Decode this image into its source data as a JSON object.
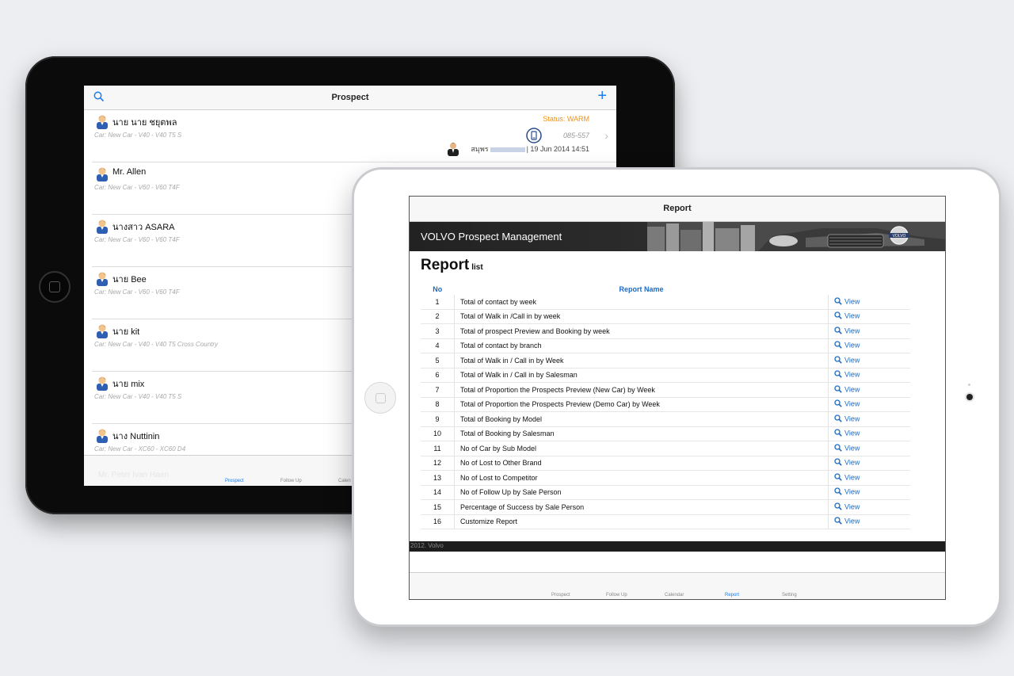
{
  "prospect": {
    "title": "Prospect",
    "items": [
      {
        "name": "นาย  นาย ชยุตพล",
        "car": "Car: New Car - V40 - V40 T5 S",
        "status": "Status: WARM",
        "phone": "085-557",
        "salesman": "สมุพร",
        "date": "| 19 Jun 2014 14:51"
      },
      {
        "name": "Mr. Allen",
        "car": "Car: New Car - V60 - V60 T4F"
      },
      {
        "name": "นางสาว ASARA",
        "car": "Car: New Car - V60 - V60 T4F"
      },
      {
        "name": "นาย Bee",
        "car": "Car: New Car - V60 - V60 T4F"
      },
      {
        "name": "นาย kit",
        "car": "Car: New Car - V40 - V40 T5 Cross Country"
      },
      {
        "name": "นาย mix",
        "car": "Car: New Car - V40 - V40 T5 S"
      },
      {
        "name": "นาง Nuttinin",
        "car": "Car: New Car - XC60 - XC60 D4"
      }
    ],
    "ghost_row": "Mr. Peter Ivan Haan",
    "tabs": [
      "Prospect",
      "Follow Up",
      "Calen"
    ],
    "active_tab": "Prospect"
  },
  "report": {
    "title": "Report",
    "banner_text": "VOLVO Prospect Management",
    "heading": "Report",
    "subheading": "list",
    "col_no": "No",
    "col_name": "Report Name",
    "view_label": "View",
    "rows": [
      {
        "no": "1",
        "name": "Total of contact by week"
      },
      {
        "no": "2",
        "name": "Total of Walk in /Call in by week"
      },
      {
        "no": "3",
        "name": "Total of prospect Preview and Booking by week"
      },
      {
        "no": "4",
        "name": "Total of contact by branch"
      },
      {
        "no": "5",
        "name": "Total of Walk in / Call in by Week"
      },
      {
        "no": "6",
        "name": "Total of Walk in / Call in by Salesman"
      },
      {
        "no": "7",
        "name": "Total of Proportion the Prospects Preview (New Car) by Week"
      },
      {
        "no": "8",
        "name": "Total of Proportion the Prospects Preview (Demo Car) by Week"
      },
      {
        "no": "9",
        "name": "Total of Booking by Model"
      },
      {
        "no": "10",
        "name": "Total of Booking by Salesman"
      },
      {
        "no": "11",
        "name": "No of Car by Sub Model"
      },
      {
        "no": "12",
        "name": "No of Lost to Other Brand"
      },
      {
        "no": "13",
        "name": "No of Lost to Competitor"
      },
      {
        "no": "14",
        "name": "No of Follow Up by Sale Person"
      },
      {
        "no": "15",
        "name": "Percentage of Success by Sale Person"
      },
      {
        "no": "16",
        "name": "Customize Report"
      }
    ],
    "footer": "2012. Volvo",
    "tabs": [
      "Prospect",
      "Follow Up",
      "Calendar",
      "Report",
      "Setting"
    ],
    "active_tab": "Report"
  },
  "colors": {
    "accent": "#1a7cf0",
    "status_warm": "#f29111",
    "link": "#1b6bc2"
  }
}
